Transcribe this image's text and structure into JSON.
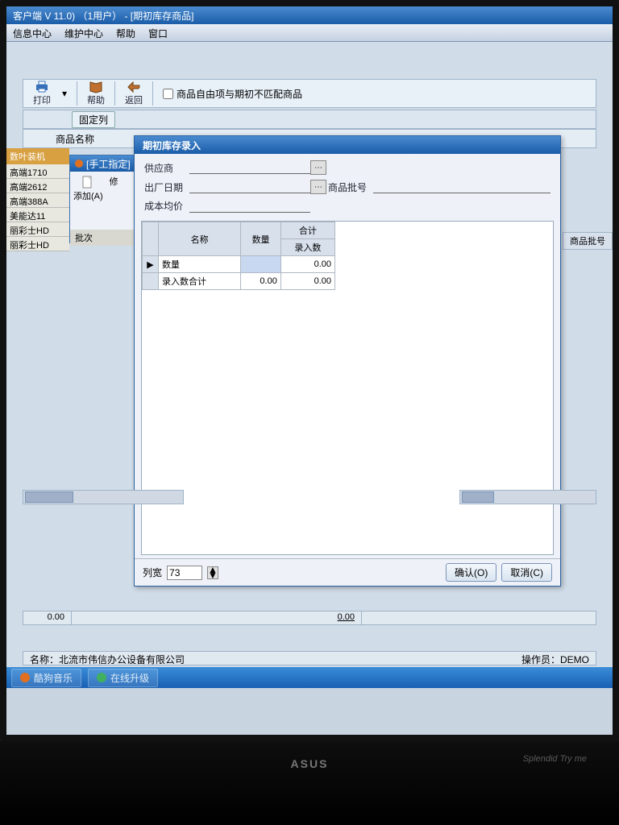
{
  "app": {
    "title": "客户端 V 11.0) （1用户） - [期初库存商品]",
    "menus": [
      "信息中心",
      "维护中心",
      "帮助",
      "窗口"
    ]
  },
  "toolbar": {
    "print": "打印",
    "help": "帮助",
    "back": "返回",
    "checkbox_label": "商品自由项与期初不匹配商品"
  },
  "bg": {
    "fixed_col": "固定列",
    "product_name": "商品名称",
    "product_batch_hdr": "商品批号"
  },
  "left_list": {
    "tab": "数叶装机",
    "rows": [
      "高端1710",
      "高端2612",
      "高端388A",
      "美能达11",
      "丽彩士HD",
      "丽彩士HD"
    ]
  },
  "subwindow": {
    "title": "[手工指定]",
    "add": "添加(A)",
    "edit": "修",
    "batch": "批次"
  },
  "dialog": {
    "title": "期初库存录入",
    "labels": {
      "supplier": "供应商",
      "factory_date": "出厂日期",
      "batch_no": "商品批号",
      "cost_avg": "成本均价"
    },
    "grid": {
      "col_name": "名称",
      "col_qty": "数量",
      "col_total": "合计",
      "col_entry": "录入数",
      "row1_name": "数量",
      "row1_entry": "0.00",
      "row2_name": "录入数合计",
      "row2_qty": "0.00",
      "row2_entry": "0.00"
    },
    "footer": {
      "colwidth_label": "列宽",
      "colwidth_value": "73",
      "ok": "确认(O)",
      "cancel": "取消(C)"
    }
  },
  "status": {
    "left_val": "0.00",
    "mid_val": "0.00",
    "company_label": "名称：",
    "company": "北流市伟信办公设备有限公司",
    "operator_label": "操作员：",
    "operator": "DEMO"
  },
  "taskbar": {
    "item1": "酷狗音乐",
    "item2": "在线升级"
  },
  "hw": {
    "brand": "ASUS",
    "tryme": "Splendid Try me"
  }
}
